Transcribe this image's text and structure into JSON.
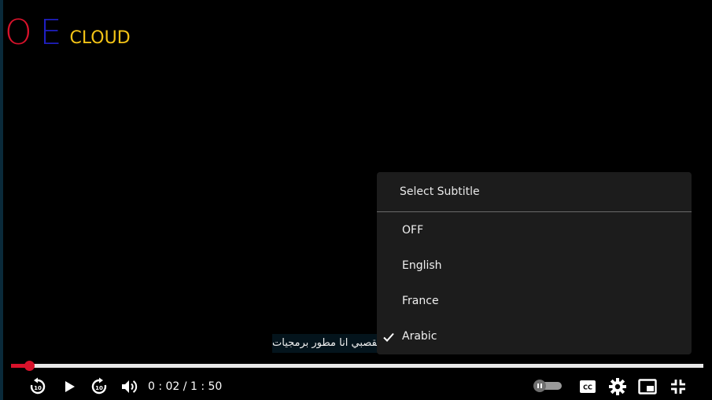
{
  "logo": {
    "o": "O",
    "e": "E",
    "cloud": "CLOUD"
  },
  "subtitle_text": "مرحبا انا اسامة القصبي انا مطور برمجيات",
  "menu": {
    "title": "Select Subtitle",
    "items": [
      {
        "label": "OFF",
        "selected": false
      },
      {
        "label": "English",
        "selected": false
      },
      {
        "label": "France",
        "selected": false
      },
      {
        "label": "Arabic",
        "selected": true
      }
    ]
  },
  "player": {
    "current_time": "0 : 02",
    "separator": " / ",
    "duration": "1 : 50",
    "progress_fraction": 0.026,
    "accent_color": "#d8122b",
    "track_color": "#e9e9e9"
  },
  "icons": {
    "rewind": "replay-10-icon",
    "play": "play-icon",
    "forward": "forward-10-icon",
    "volume": "volume-icon",
    "autoplay": "autoplay-toggle-icon",
    "captions": "captions-icon",
    "settings": "gear-icon",
    "pip": "picture-in-picture-icon",
    "exit_fullscreen": "exit-fullscreen-icon"
  }
}
